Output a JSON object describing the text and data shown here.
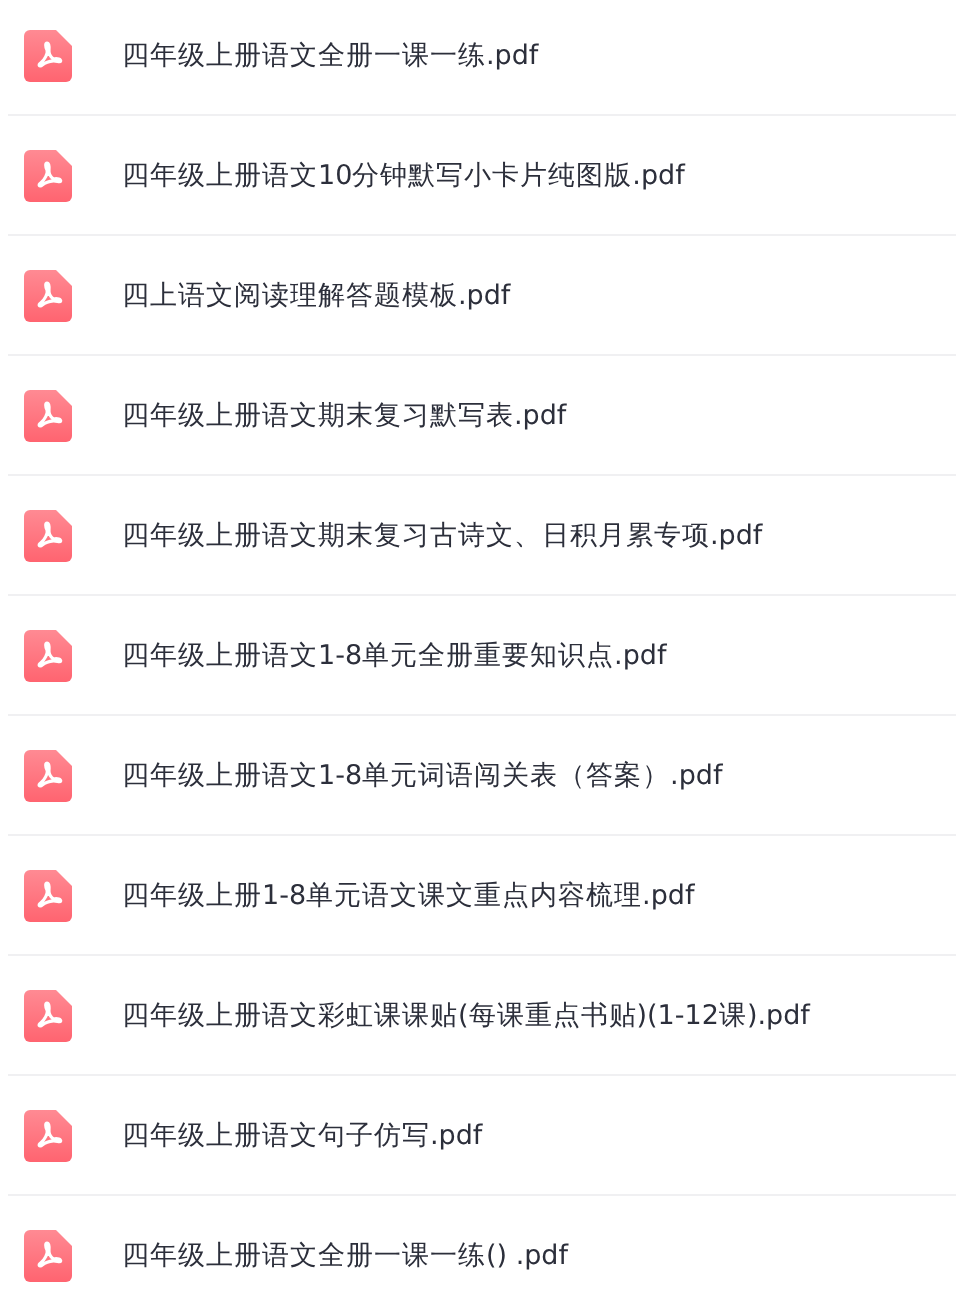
{
  "files": [
    {
      "name": "四年级上册语文全册一课一练.pdf"
    },
    {
      "name": "四年级上册语文10分钟默写小卡片纯图版.pdf"
    },
    {
      "name": "四上语文阅读理解答题模板.pdf"
    },
    {
      "name": "四年级上册语文期末复习默写表.pdf"
    },
    {
      "name": "四年级上册语文期末复习古诗文、日积月累专项.pdf"
    },
    {
      "name": "四年级上册语文1-8单元全册重要知识点.pdf"
    },
    {
      "name": "四年级上册语文1-8单元词语闯关表（答案）.pdf"
    },
    {
      "name": "四年级上册1-8单元语文课文重点内容梳理.pdf"
    },
    {
      "name": "四年级上册语文彩虹课课贴(每课重点书贴)(1-12课).pdf"
    },
    {
      "name": "四年级上册语文句子仿写.pdf"
    },
    {
      "name": "四年级上册语文全册一课一练() .pdf"
    }
  ]
}
